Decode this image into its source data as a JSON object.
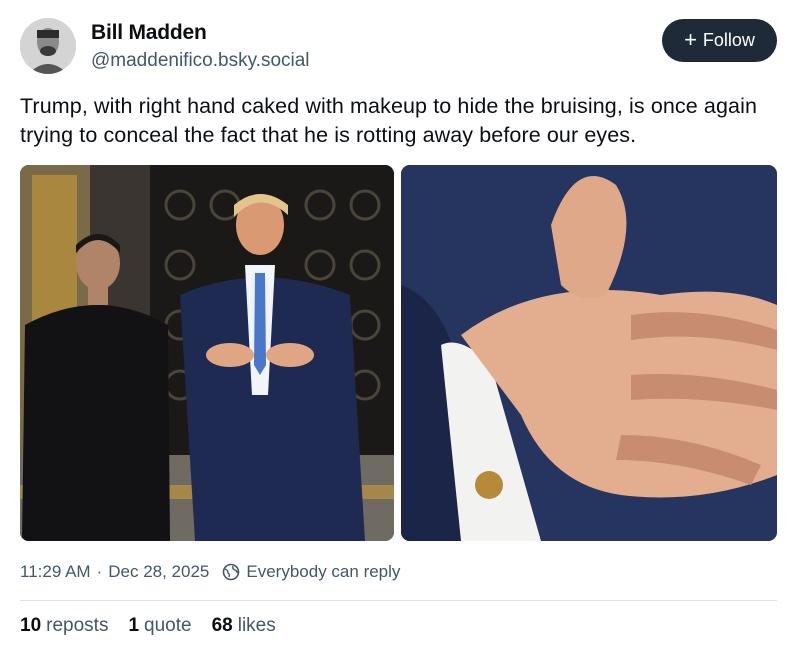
{
  "author": {
    "name": "Bill Madden",
    "handle": "@maddenifico.bsky.social"
  },
  "follow_button": {
    "label": "Follow",
    "icon": "plus-icon"
  },
  "post": {
    "text": "Trump, with right hand caked with makeup to hide the bruising, is once again trying to conceal the fact that he is rotting away before our eyes."
  },
  "images": [
    {
      "alt": ""
    },
    {
      "alt": ""
    }
  ],
  "meta": {
    "time": "11:29 AM",
    "separator": "·",
    "date": "Dec 28, 2025",
    "reply_setting": "Everybody can reply",
    "reply_icon": "globe-icon"
  },
  "stats": {
    "reposts": {
      "count": "10",
      "label": "reposts"
    },
    "quotes": {
      "count": "1",
      "label": "quote"
    },
    "likes": {
      "count": "68",
      "label": "likes"
    }
  },
  "colors": {
    "follow_bg": "#1e2a38",
    "secondary_text": "#42576c",
    "divider": "#dde3ea"
  }
}
